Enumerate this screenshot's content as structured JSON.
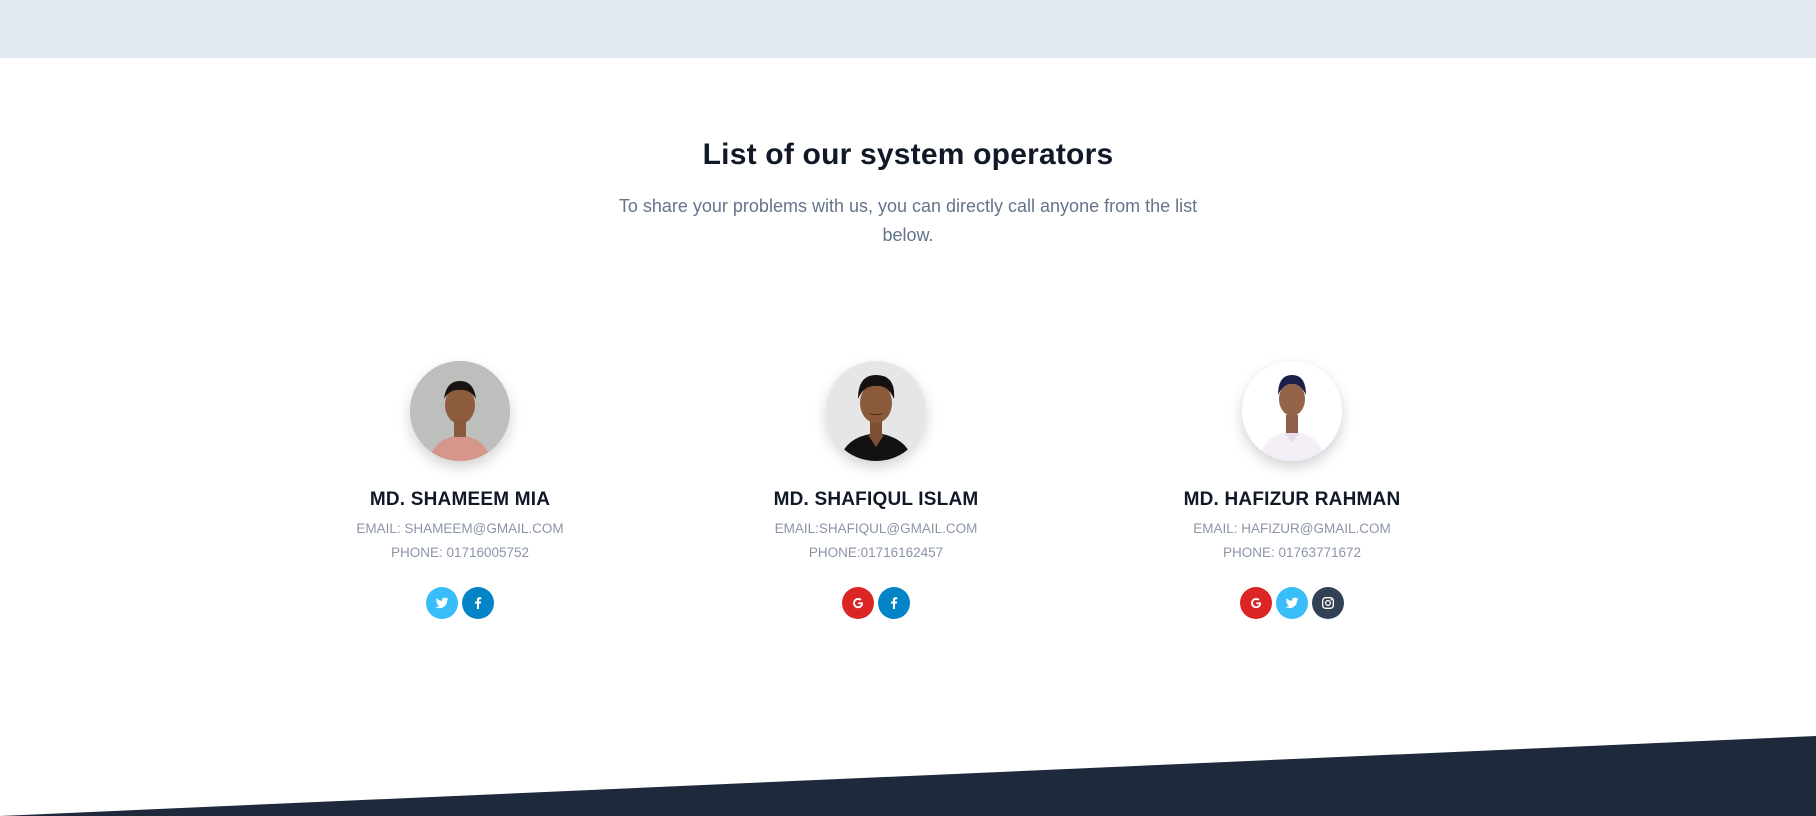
{
  "section": {
    "title": "List of our system operators",
    "subtitle": "To share your problems with us, you can directly call anyone from the list below."
  },
  "colors": {
    "google": "#dc2626",
    "twitter": "#38bdf8",
    "facebook": "#0284c7",
    "instagram": "#334155",
    "footer": "#1e293b",
    "top_band": "#e2e8f0"
  },
  "operators": [
    {
      "name": "MD. SHAMEEM MIA",
      "email": "EMAIL: SHAMEEM@GMAIL.COM",
      "phone": "PHONE: 01716005752",
      "socials": [
        "twitter-icon",
        "facebook-icon"
      ]
    },
    {
      "name": "MD. SHAFIQUL ISLAM",
      "email": "EMAIL:SHAFIQUL@GMAIL.COM",
      "phone": "PHONE:01716162457",
      "socials": [
        "google-icon",
        "facebook-icon"
      ]
    },
    {
      "name": "MD. HAFIZUR RAHMAN",
      "email": "EMAIL: HAFIZUR@GMAIL.COM",
      "phone": "PHONE: 01763771672",
      "socials": [
        "google-icon",
        "twitter-icon",
        "instagram-icon"
      ]
    }
  ]
}
